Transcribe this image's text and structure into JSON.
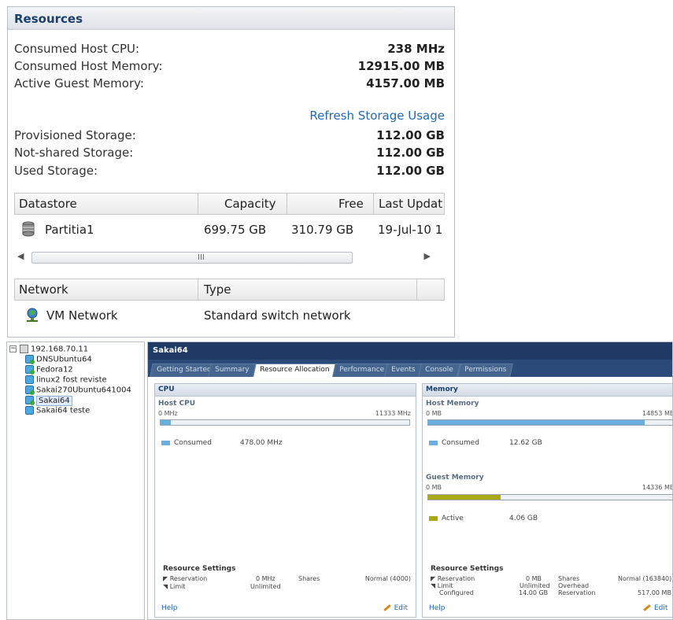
{
  "resources": {
    "title": "Resources",
    "rows": [
      {
        "label": "Consumed Host CPU:",
        "value": "238 MHz"
      },
      {
        "label": "Consumed Host Memory:",
        "value": "12915.00 MB"
      },
      {
        "label": "Active Guest Memory:",
        "value": "4157.00 MB"
      }
    ],
    "refresh_link": "Refresh Storage Usage",
    "storage_rows": [
      {
        "label": "Provisioned Storage:",
        "value": "112.00 GB"
      },
      {
        "label": "Not-shared Storage:",
        "value": "112.00 GB"
      },
      {
        "label": "Used Storage:",
        "value": "112.00 GB"
      }
    ],
    "datastore_table": {
      "headers": [
        "Datastore",
        "Capacity",
        "Free",
        "Last Updat"
      ],
      "rows": [
        {
          "name": "Partitia1",
          "capacity": "699.75 GB",
          "free": "310.79 GB",
          "last_update": "19-Jul-10 1"
        }
      ],
      "scroll_grip": "III"
    },
    "network_table": {
      "headers": [
        "Network",
        "Type"
      ],
      "rows": [
        {
          "name": "VM Network",
          "type": "Standard switch network"
        }
      ]
    }
  },
  "tree": {
    "host": "192.168.70.11",
    "vms": [
      "DNSUbuntu64",
      "Fedora12",
      "linux2 fost reviste",
      "Sakai270Ubuntu641004",
      "Sakai64",
      "Sakai64 teste"
    ],
    "selected": "Sakai64"
  },
  "vm": {
    "title": "Sakai64",
    "tabs": [
      "Getting Started",
      "Summary",
      "Resource Allocation",
      "Performance",
      "Events",
      "Console",
      "Permissions"
    ],
    "active_tab": "Resource Allocation",
    "cpu": {
      "header": "CPU",
      "sub": "Host CPU",
      "min": "0 MHz",
      "max": "11333 MHz",
      "consumed_fraction": 0.04,
      "legend_label": "Consumed",
      "legend_value": "478.00 MHz",
      "settings_title": "Resource Settings",
      "reservation_label": "Reservation",
      "reservation_value": "0 MHz",
      "limit_label": "Limit",
      "limit_value": "Unlimited",
      "shares_label": "Shares",
      "shares_value": "Normal (4000)",
      "help": "Help",
      "edit": "Edit"
    },
    "memory": {
      "header": "Memory",
      "host_sub": "Host Memory",
      "host_min": "0 MB",
      "host_max": "14853 MB",
      "host_fraction": 0.87,
      "consumed_label": "Consumed",
      "consumed_value": "12.62 GB",
      "guest_sub": "Guest Memory",
      "guest_min": "0 MB",
      "guest_max": "14336 MB",
      "guest_fraction": 0.29,
      "active_label": "Active",
      "active_value": "4.06 GB",
      "settings_title": "Resource Settings",
      "reservation_label": "Reservation",
      "reservation_value": "0 MB",
      "limit_label": "Limit",
      "limit_value": "Unlimited",
      "configured_label": "Configured",
      "configured_value": "14.00 GB",
      "shares_label": "Shares",
      "shares_value": "Normal (163840)",
      "overhead_label": "Overhead",
      "overhead_reservation_label": "Reservation",
      "overhead_reservation_value": "517.00 MB",
      "help": "Help",
      "edit": "Edit"
    },
    "colors": {
      "cpu_bar": "#6aaee0",
      "host_mem_bar": "#6aaee0",
      "guest_mem_bar": "#a8a817"
    }
  }
}
